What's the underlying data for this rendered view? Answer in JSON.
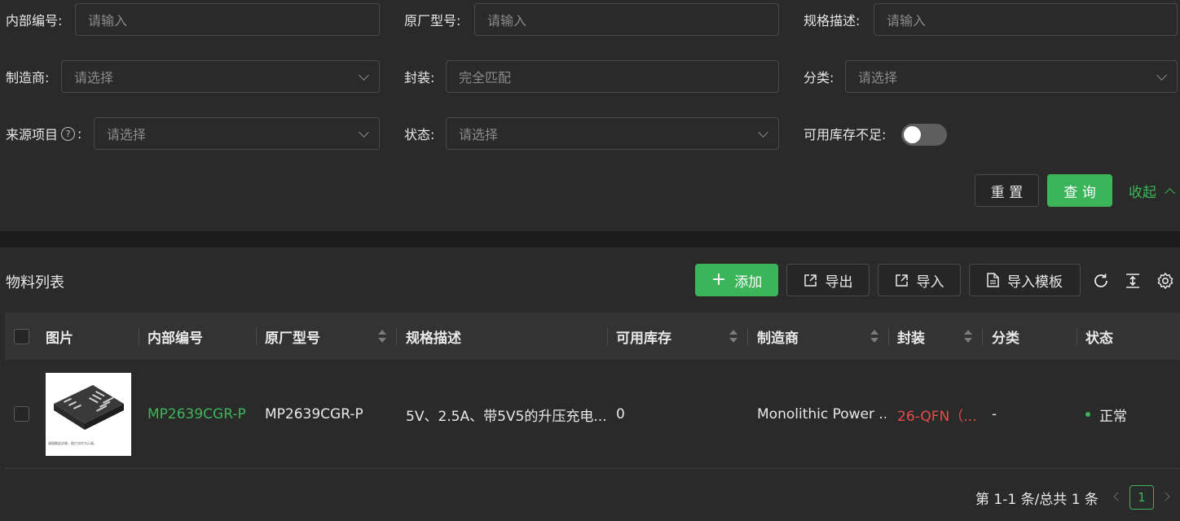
{
  "filters": {
    "internal_no": {
      "label": "内部编号:",
      "placeholder": "请输入"
    },
    "mfr_part_no": {
      "label": "原厂型号:",
      "placeholder": "请输入"
    },
    "spec_desc": {
      "label": "规格描述:",
      "placeholder": "请输入"
    },
    "manufacturer": {
      "label": "制造商:",
      "placeholder": "请选择"
    },
    "package": {
      "label": "封装:",
      "placeholder": "完全匹配"
    },
    "category": {
      "label": "分类:",
      "placeholder": "请选择"
    },
    "source_project": {
      "label": "来源项目",
      "help": "?",
      "colon": ":",
      "placeholder": "请选择"
    },
    "status": {
      "label": "状态:",
      "placeholder": "请选择"
    },
    "low_stock": {
      "label": "可用库存不足:",
      "enabled": false
    }
  },
  "actions": {
    "reset": "重 置",
    "query": "查 询",
    "collapse": "收起"
  },
  "list": {
    "title": "物料列表",
    "toolbar": {
      "add": "添加",
      "add_icon": "+",
      "export": "导出",
      "import": "导入",
      "import_template": "导入模板"
    },
    "columns": [
      "图片",
      "内部编号",
      "原厂型号",
      "规格描述",
      "可用库存",
      "制造商",
      "封装",
      "分类",
      "状态"
    ],
    "rows": [
      {
        "internal_no": "MP2639CGR-P",
        "mfr_part_no": "MP2639CGR-P",
        "spec_desc": "5V、2.5A、带5V5的升压充电...",
        "available_stock": "0",
        "manufacturer": "Monolithic Power ...",
        "package": "26-QFN（...",
        "category": "-",
        "status": "正常",
        "image_caption": "请理解此封装，图片仅作为示意。"
      }
    ],
    "pagination": {
      "summary": "第 1-1 条/总共 1 条",
      "current": "1"
    }
  },
  "colors": {
    "accent": "#3cb55a",
    "package_text": "#e84a4a",
    "background": "#2a2a2a"
  }
}
